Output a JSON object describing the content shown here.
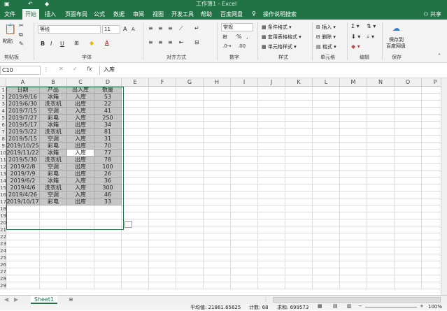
{
  "window": {
    "title": "工作簿1 - Excel"
  },
  "tabs": [
    "文件",
    "开始",
    "插入",
    "页面布局",
    "公式",
    "数据",
    "审阅",
    "视图",
    "开发工具",
    "帮助",
    "百度网盘"
  ],
  "tell_me": "操作说明搜索",
  "share": "共享",
  "ribbon": {
    "clipboard": {
      "label": "剪贴板",
      "paste": "粘贴"
    },
    "font": {
      "label": "字体",
      "font_name": "等线",
      "font_size": "11",
      "bold": "B",
      "italic": "I",
      "underline": "U",
      "grow": "A",
      "shrink": "A"
    },
    "alignment": {
      "label": "对齐方式"
    },
    "number": {
      "label": "数字",
      "format": "常规",
      "percent": "%",
      "comma": ","
    },
    "styles": {
      "label": "样式",
      "conditional": "条件格式",
      "table": "套用表格格式",
      "cell_styles": "单元格样式"
    },
    "cells": {
      "label": "单元格",
      "insert": "插入",
      "delete": "删除",
      "format": "格式"
    },
    "editing": {
      "label": "编辑"
    },
    "save": {
      "label": "保存",
      "button": "保存到",
      "button2": "百度网盘"
    }
  },
  "formula_bar": {
    "name_box": "C10",
    "fx": "fx",
    "value": "入库"
  },
  "columns": [
    "A",
    "B",
    "C",
    "D",
    "E",
    "F",
    "G",
    "H",
    "I",
    "J",
    "K",
    "L",
    "M",
    "N",
    "O",
    "P"
  ],
  "rows": [
    "1",
    "2",
    "3",
    "4",
    "5",
    "6",
    "7",
    "8",
    "9",
    "10",
    "11",
    "12",
    "13",
    "14",
    "15",
    "16",
    "17",
    "18",
    "19",
    "20",
    "21",
    "22",
    "23",
    "24",
    "25",
    "26",
    "27",
    "28",
    "29"
  ],
  "table": {
    "headers": [
      "日期",
      "产品",
      "出入库",
      "数量"
    ],
    "data": [
      [
        "2019/9/16",
        "冰箱",
        "入库",
        "53"
      ],
      [
        "2019/6/30",
        "洗衣机",
        "出库",
        "22"
      ],
      [
        "2019/7/15",
        "空调",
        "入库",
        "41"
      ],
      [
        "2019/7/27",
        "彩电",
        "入库",
        "250"
      ],
      [
        "2019/5/17",
        "冰箱",
        "出库",
        "34"
      ],
      [
        "2019/3/22",
        "洗衣机",
        "出库",
        "81"
      ],
      [
        "2019/5/15",
        "空调",
        "入库",
        "31"
      ],
      [
        "2019/10/25",
        "彩电",
        "出库",
        "70"
      ],
      [
        "2019/11/22",
        "冰箱",
        "入库",
        "77"
      ],
      [
        "2019/5/30",
        "洗衣机",
        "出库",
        "78"
      ],
      [
        "2019/2/8",
        "空调",
        "出库",
        "100"
      ],
      [
        "2019/7/9",
        "彩电",
        "出库",
        "26"
      ],
      [
        "2019/6/2",
        "冰箱",
        "入库",
        "36"
      ],
      [
        "2019/4/6",
        "洗衣机",
        "入库",
        "300"
      ],
      [
        "2019/4/26",
        "空调",
        "入库",
        "46"
      ],
      [
        "2019/10/17",
        "彩电",
        "出库",
        "33"
      ]
    ]
  },
  "sheet": {
    "name": "Sheet1"
  },
  "status": {
    "average": "平均值: 21861.65625",
    "count": "计数: 68",
    "sum": "求和: 699573",
    "zoom": "100%"
  },
  "colors": {
    "accent": "#217346"
  }
}
